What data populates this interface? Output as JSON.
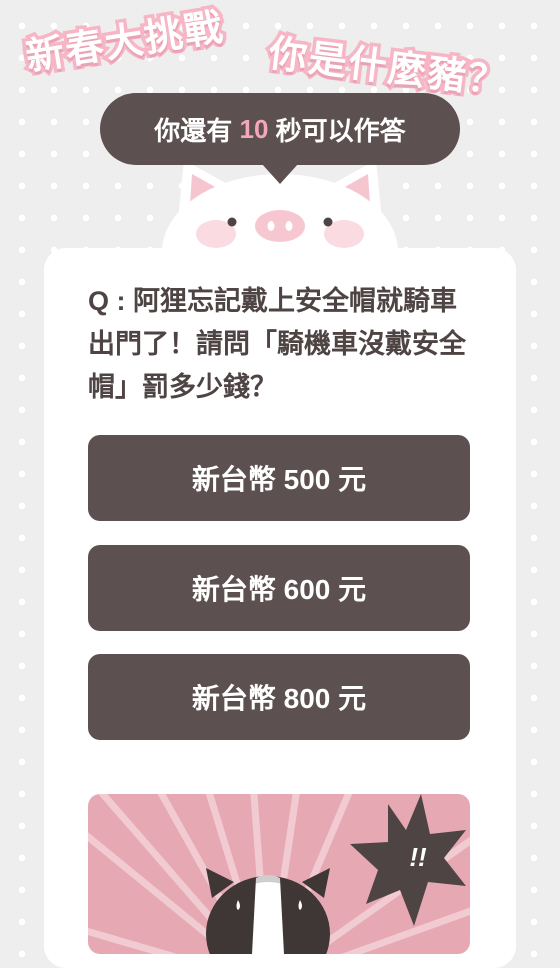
{
  "header": {
    "title_part1": "新春大挑戰",
    "title_part2": "你是什麼豬？"
  },
  "timer": {
    "prefix": "你還有 ",
    "seconds": "10",
    "suffix": " 秒可以作答"
  },
  "quiz": {
    "question": "Q : 阿狸忘記戴上安全帽就騎車出門了！請問「騎機車沒戴安全帽」罰多少錢？",
    "options": [
      {
        "label": "新台幣 500 元"
      },
      {
        "label": "新台幣 600 元"
      },
      {
        "label": "新台幣 800 元"
      }
    ]
  },
  "illustration": {
    "exclaim": "!!"
  },
  "colors": {
    "primary_dark": "#5c5050",
    "accent_pink": "#f3a7ba",
    "title_pink": "#f6b6c6",
    "background": "#eeeeee",
    "illustration_bg": "#e6a9b3"
  },
  "icons": {
    "mascot": "pig-face-icon",
    "character": "skunk-character-icon",
    "burst": "exclamation-burst-icon"
  }
}
